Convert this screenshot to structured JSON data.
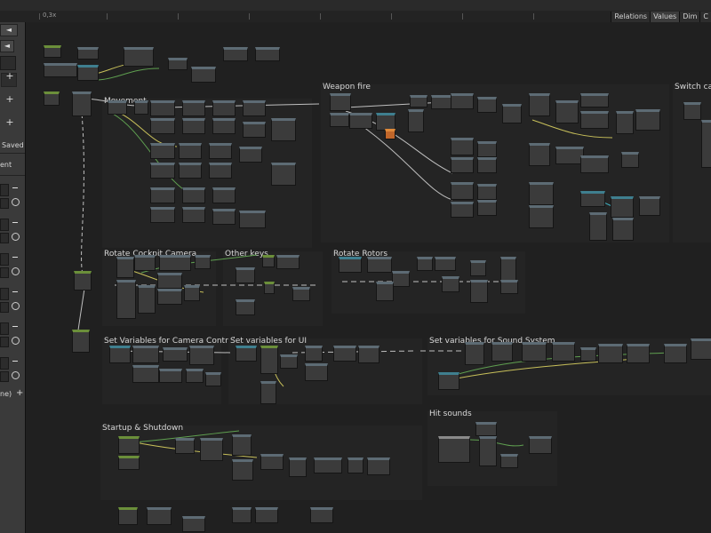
{
  "toolbar": {
    "zoom_label": "0,3x"
  },
  "tabs": [
    {
      "label": "Relations",
      "active": false
    },
    {
      "label": "Values",
      "active": true
    },
    {
      "label": "Dim",
      "active": false
    },
    {
      "label": "C",
      "active": false
    }
  ],
  "sidebar": {
    "saved_label": "Saved",
    "ent_label": "ent",
    "ne_label": "ne)",
    "add_symbol": "+",
    "remove_symbol": "–",
    "toggle_symbol": "◄"
  },
  "groups": [
    {
      "title": "Movement"
    },
    {
      "title": "Weapon fire"
    },
    {
      "title": "Switch cam"
    },
    {
      "title": "Rotate Cockpit Camera"
    },
    {
      "title": "Other keys"
    },
    {
      "title": "Rotate Rotors"
    },
    {
      "title": "Set Variables for Camera Control"
    },
    {
      "title": "Set variables for UI"
    },
    {
      "title": "Set variables for Sound System"
    },
    {
      "title": "Hit sounds"
    },
    {
      "title": "Startup & Shutdown"
    }
  ],
  "colors": {
    "accent_green": "#6b8f3a",
    "accent_cyan": "#3f7f8f",
    "accent_orange": "#c0662a",
    "wire_yellow": "#c8c05a",
    "wire_green": "#5fa050",
    "wire_white": "#bfbfbf",
    "wire_cyan": "#3fb0c0"
  }
}
